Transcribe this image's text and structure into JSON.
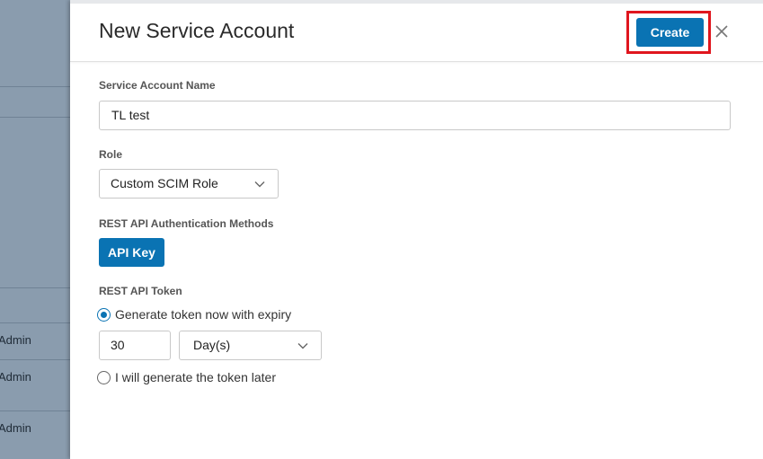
{
  "backdrop": {
    "rows": [
      "Admin",
      "Admin",
      "Admin"
    ]
  },
  "dialog": {
    "title": "New Service Account",
    "create_label": "Create",
    "close_icon": "close-icon"
  },
  "form": {
    "name_label": "Service Account Name",
    "name_value": "TL test",
    "role_label": "Role",
    "role_value": "Custom SCIM Role",
    "auth_label": "REST API Authentication Methods",
    "auth_button": "API Key",
    "token_label": "REST API Token",
    "option_now_label": "Generate token now with expiry",
    "option_now_selected": true,
    "expiry_value": "30",
    "expiry_unit": "Day(s)",
    "option_later_label": "I will generate the token later",
    "option_later_selected": false
  },
  "colors": {
    "primary": "#0a73b3",
    "highlight": "#e0161e",
    "backdrop": "#8a9cae"
  }
}
